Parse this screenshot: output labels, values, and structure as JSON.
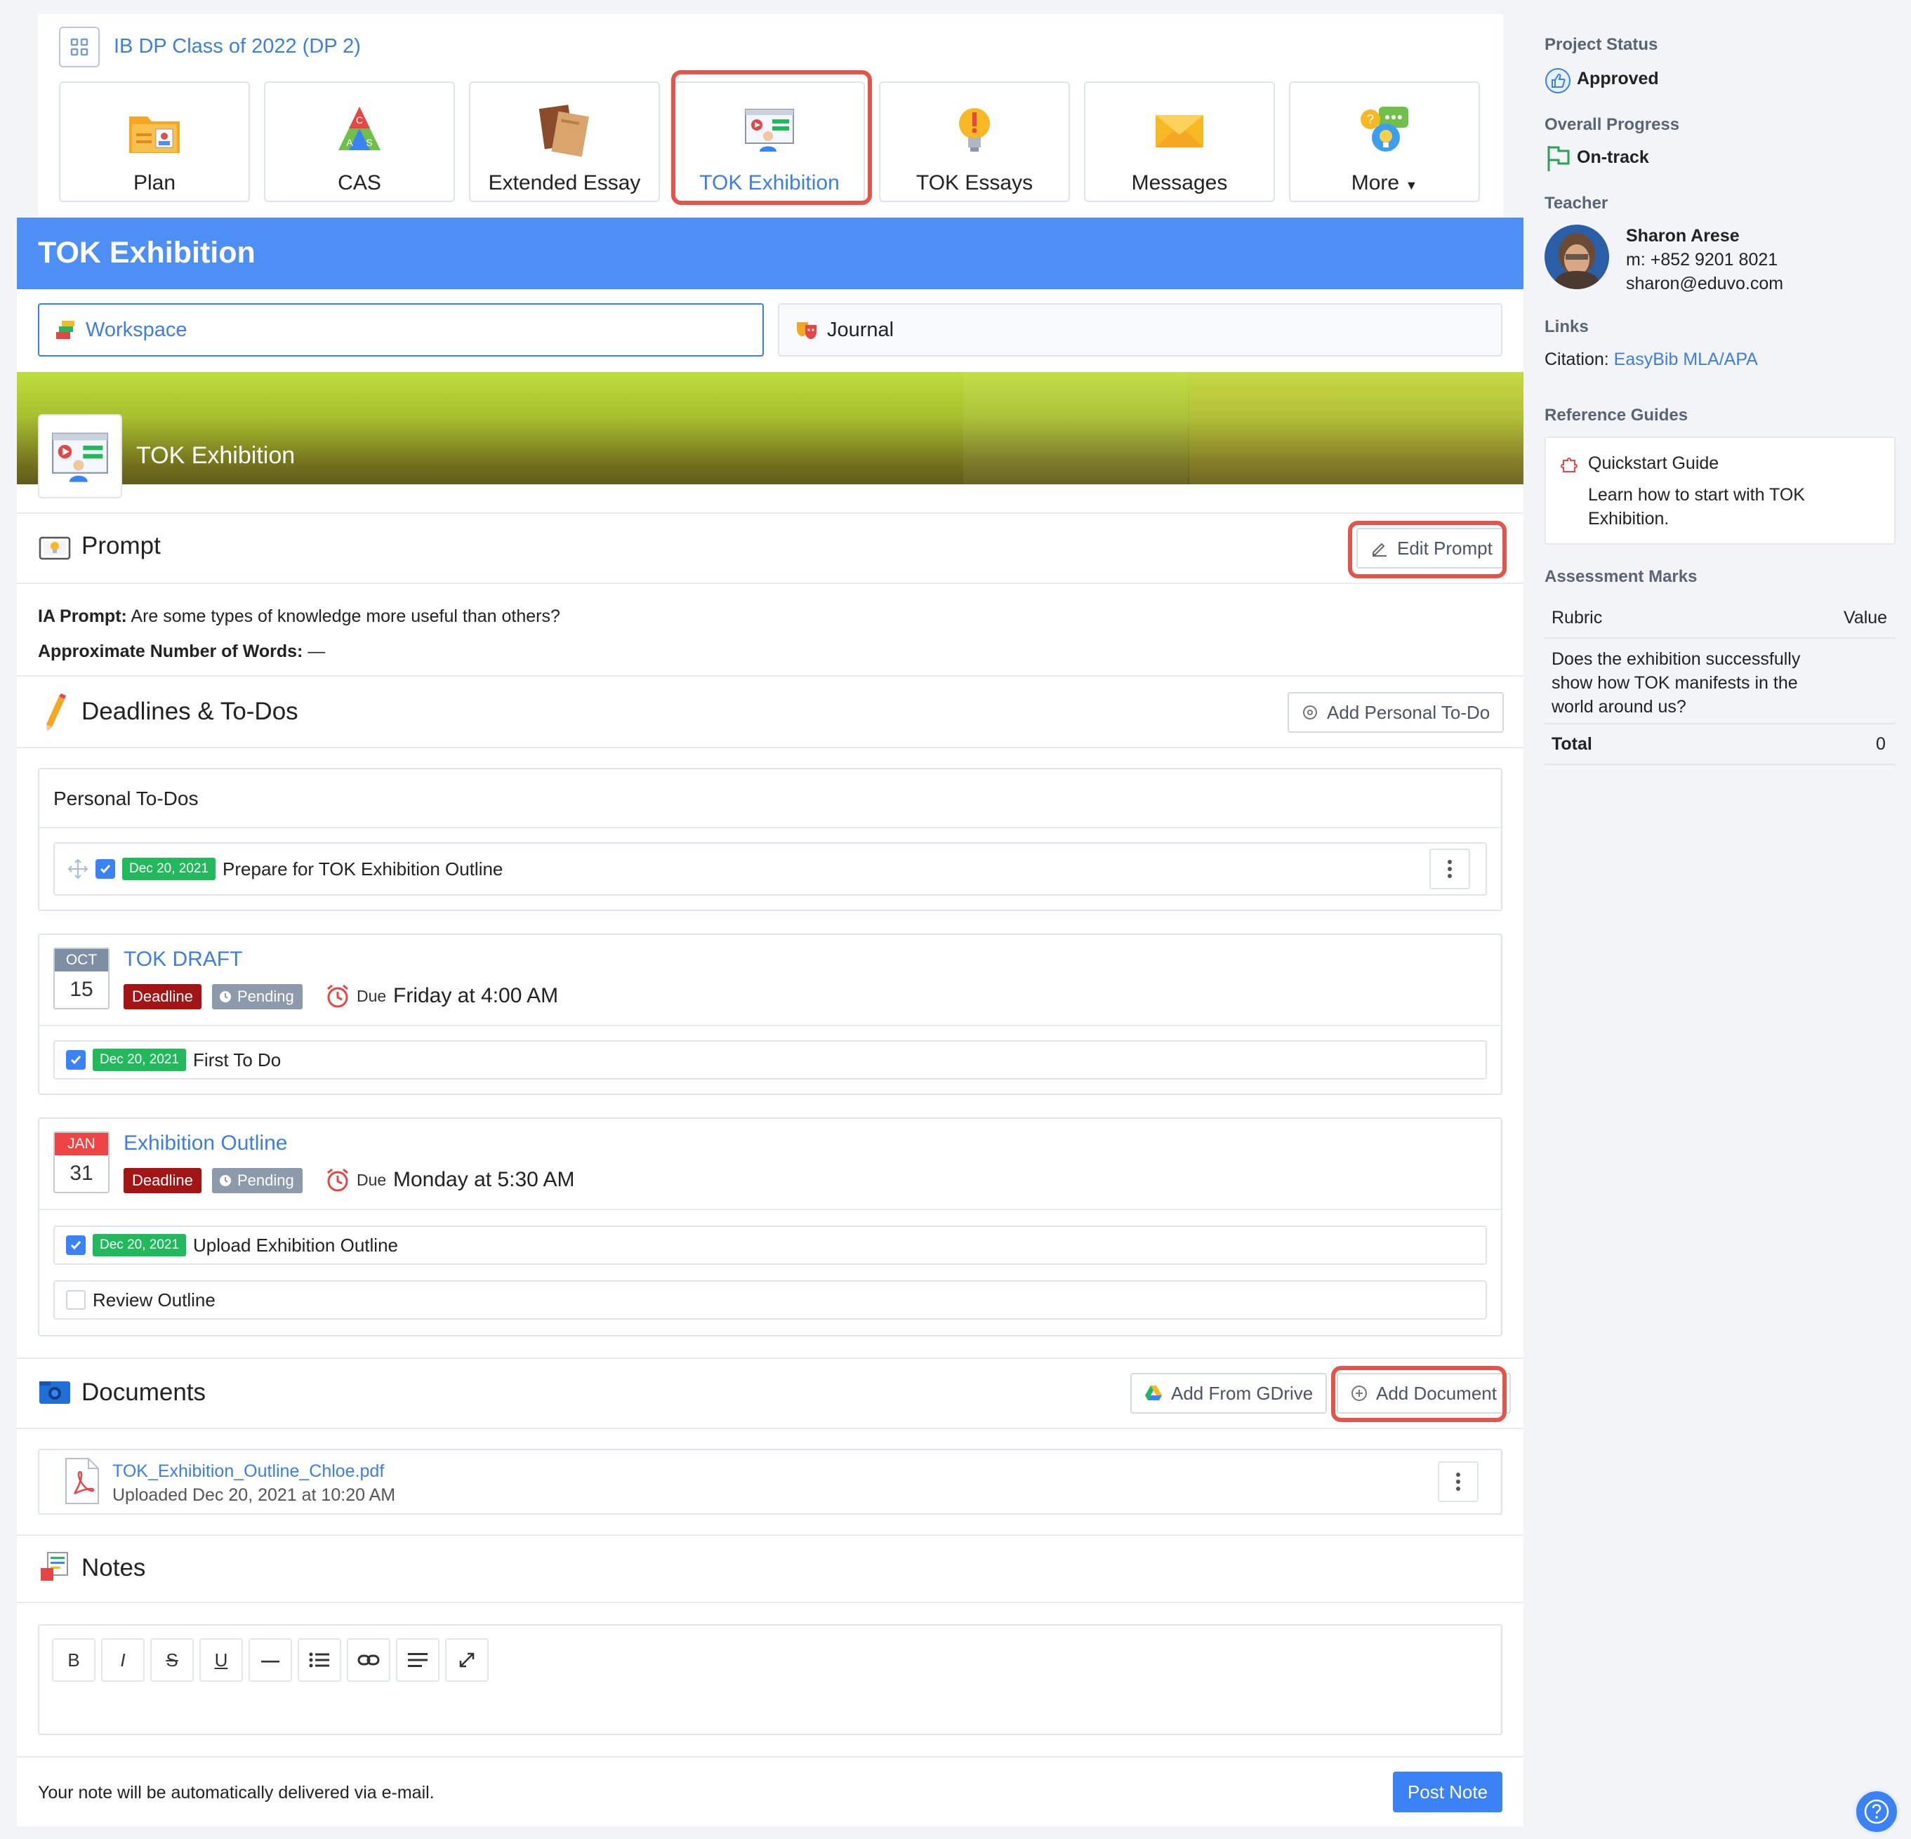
{
  "nav": {
    "class_name": "IB DP Class of 2022 (DP 2)",
    "tiles": [
      {
        "label": "Plan",
        "icon": "plan-folder-icon"
      },
      {
        "label": "CAS",
        "icon": "cas-triangle-icon"
      },
      {
        "label": "Extended Essay",
        "icon": "extended-essay-books-icon"
      },
      {
        "label": "TOK Exhibition",
        "icon": "tok-exhibition-presentation-icon",
        "active": true
      },
      {
        "label": "TOK Essays",
        "icon": "lightbulb-icon"
      },
      {
        "label": "Messages",
        "icon": "envelope-icon"
      },
      {
        "label": "More",
        "icon": "chat-bubbles-icon"
      }
    ]
  },
  "page": {
    "title": "TOK Exhibition",
    "tabs": {
      "workspace": "Workspace",
      "journal": "Journal"
    },
    "banner_title": "TOK Exhibition"
  },
  "prompt": {
    "title": "Prompt",
    "edit_label": "Edit Prompt",
    "ia_label": "IA Prompt:",
    "ia_text": "Are some types of knowledge more useful than others?",
    "words_label": "Approximate Number of Words:",
    "words_value": "—"
  },
  "deadlines": {
    "title": "Deadlines & To-Dos",
    "add_label": "Add Personal To-Do",
    "personal_title": "Personal To-Dos",
    "personal_todo": {
      "date": "Dec 20, 2021",
      "text": "Prepare for TOK Exhibition Outline",
      "checked": true
    },
    "items": [
      {
        "month": "OCT",
        "day": "15",
        "title": "TOK DRAFT",
        "badge": "Deadline",
        "status": "Pending",
        "due_label": "Due",
        "due_time": "Friday at 4:00 AM",
        "todos": [
          {
            "date": "Dec 20, 2021",
            "text": "First To Do",
            "checked": true
          }
        ]
      },
      {
        "month": "JAN",
        "day": "31",
        "title": "Exhibition Outline",
        "badge": "Deadline",
        "status": "Pending",
        "due_label": "Due",
        "due_time": "Monday at 5:30 AM",
        "todos": [
          {
            "date": "Dec 20, 2021",
            "text": "Upload Exhibition Outline",
            "checked": true
          },
          {
            "text": "Review Outline",
            "checked": false
          }
        ]
      }
    ]
  },
  "documents": {
    "title": "Documents",
    "gdrive_label": "Add From GDrive",
    "add_label": "Add Document",
    "files": [
      {
        "name": "TOK_Exhibition_Outline_Chloe.pdf",
        "meta": "Uploaded Dec 20, 2021 at 10:20 AM"
      }
    ]
  },
  "notes": {
    "title": "Notes",
    "toolbar": [
      "B",
      "I",
      "S",
      "U",
      "—",
      "list",
      "link",
      "align",
      "expand"
    ],
    "footer_text": "Your note will be automatically delivered via e-mail.",
    "post_label": "Post Note"
  },
  "sidebar": {
    "status_label": "Project Status",
    "status_value": "Approved",
    "progress_label": "Overall Progress",
    "progress_value": "On-track",
    "teacher_label": "Teacher",
    "teacher_name": "Sharon Arese",
    "teacher_phone": "m: +852 9201 8021",
    "teacher_email": "sharon@eduvo.com",
    "links_label": "Links",
    "citation_label": "Citation:",
    "citation_link": "EasyBib MLA/APA",
    "guides_label": "Reference Guides",
    "guide_title": "Quickstart Guide",
    "guide_desc": "Learn how to start with TOK Exhibition.",
    "marks_label": "Assessment Marks",
    "rubric_header": "Rubric",
    "value_header": "Value",
    "rubric_row": "Does the exhibition successfully show how TOK manifests in the world around us?",
    "total_label": "Total",
    "total_value": "0"
  },
  "colors": {
    "accent": "#4d8ff7",
    "link": "#3d7fe0",
    "deadline": "#a31515",
    "date_badge": "#22b85c",
    "highlight": "#e5534b"
  }
}
